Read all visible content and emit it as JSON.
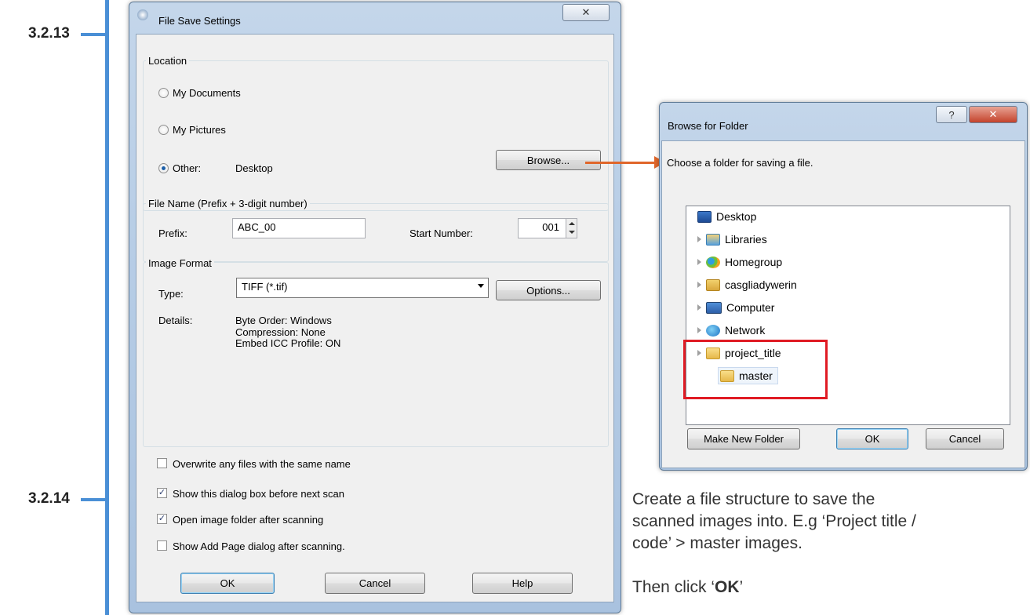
{
  "steps": {
    "first": "3.2.13",
    "second": "3.2.14"
  },
  "file_save_dialog": {
    "title": "File Save Settings",
    "close_glyph": "✕",
    "location": {
      "label": "Location",
      "my_documents": "My Documents",
      "my_pictures": "My Pictures",
      "other": "Other:",
      "other_value": "Desktop",
      "browse_button": "Browse..."
    },
    "file_name": {
      "label": "File Name (Prefix + 3-digit number)",
      "prefix_label": "Prefix:",
      "prefix_value": "ABC_00",
      "start_number_label": "Start Number:",
      "start_number_value": "001"
    },
    "image_format": {
      "label": "Image Format",
      "type_label": "Type:",
      "type_value": "TIFF (*.tif)",
      "options_button": "Options...",
      "details_label": "Details:",
      "details_line1": "Byte Order: Windows",
      "details_line2": "Compression: None",
      "details_line3": "Embed ICC Profile: ON"
    },
    "checkboxes": {
      "overwrite": "Overwrite any files with the same name",
      "show_dialog": "Show this dialog box before next scan",
      "open_folder": "Open image folder after scanning",
      "show_add_page": "Show Add Page dialog after scanning."
    },
    "buttons": {
      "ok": "OK",
      "cancel": "Cancel",
      "help": "Help"
    }
  },
  "browse_dialog": {
    "title": "Browse for Folder",
    "help_glyph": "?",
    "close_glyph": "✕",
    "instruction": "Choose a folder for saving a file.",
    "tree": {
      "desktop": "Desktop",
      "libraries": "Libraries",
      "homegroup": "Homegroup",
      "user": "casgliadywerin",
      "computer": "Computer",
      "network": "Network",
      "project": "project_title",
      "master": "master"
    },
    "buttons": {
      "make_new_folder": "Make New Folder",
      "ok": "OK",
      "cancel": "Cancel"
    }
  },
  "caption": {
    "line1": "Create a file structure to save the",
    "line2": "scanned images into. E.g ‘Project title /",
    "line3": "code’ > master images.",
    "then_prefix": "Then click ‘",
    "then_bold": "OK",
    "then_suffix": "’"
  },
  "colors": {
    "accent_blue": "#4a8fd6",
    "arrow_orange": "#e0662a",
    "highlight_red": "#e01b24"
  }
}
